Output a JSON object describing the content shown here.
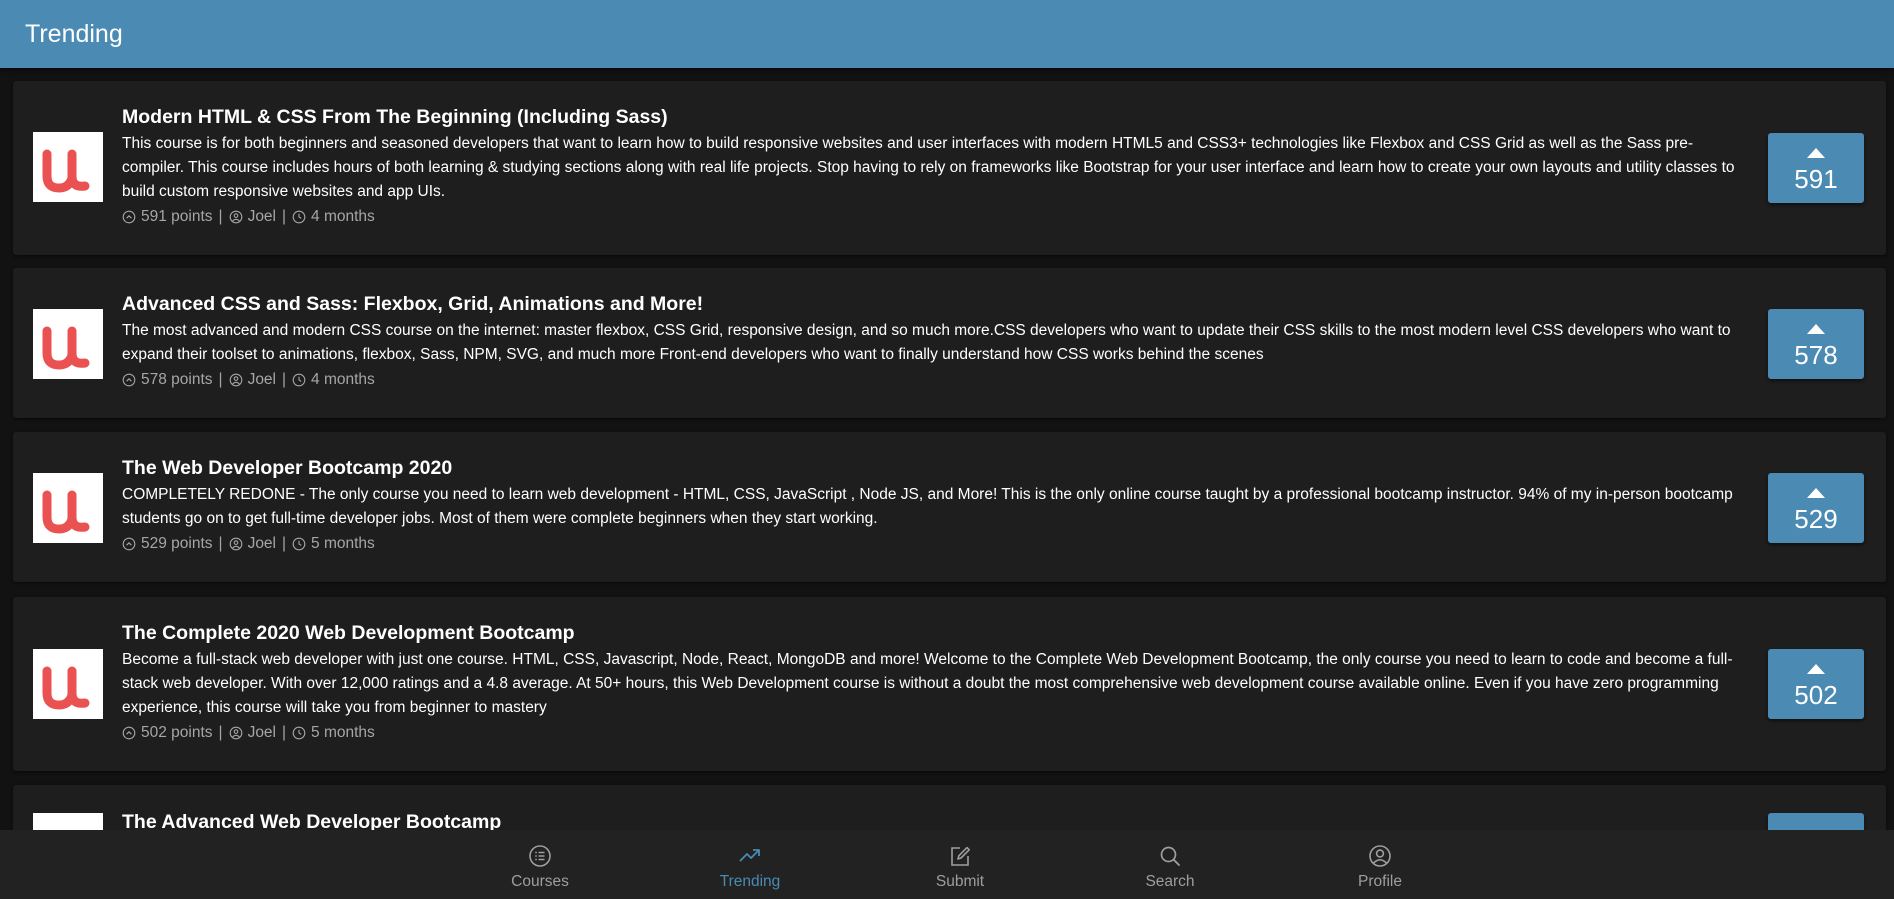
{
  "header": {
    "title": "Trending"
  },
  "courses": [
    {
      "title": "Modern HTML & CSS From The Beginning (Including Sass)",
      "description": "This course is for both beginners and seasoned developers that want to learn how to build responsive websites and user interfaces with modern HTML5 and CSS3+ technologies like Flexbox and CSS Grid as well as the Sass pre-compiler. This course includes hours of both learning & studying sections along with real life projects. Stop having to rely on frameworks like Bootstrap for your user interface and learn how to create your own layouts and utility classes to build custom responsive websites and app UIs.",
      "points": "591 points",
      "author": "Joel",
      "age": "4 months",
      "votes": "591"
    },
    {
      "title": "Advanced CSS and Sass: Flexbox, Grid, Animations and More!",
      "description": "The most advanced and modern CSS course on the internet: master flexbox, CSS Grid, responsive design, and so much more.CSS developers who want to update their CSS skills to the most modern level CSS developers who want to expand their toolset to animations, flexbox, Sass, NPM, SVG, and much more Front-end developers who want to finally understand how CSS works behind the scenes",
      "points": "578 points",
      "author": "Joel",
      "age": "4 months",
      "votes": "578"
    },
    {
      "title": "The Web Developer Bootcamp 2020",
      "description": "COMPLETELY REDONE - The only course you need to learn web development - HTML, CSS, JavaScript , Node JS, and More! This is the only online course taught by a professional bootcamp instructor. 94% of my in-person bootcamp students go on to get full-time developer jobs. Most of them were complete beginners when they start working.",
      "points": "529 points",
      "author": "Joel",
      "age": "5 months",
      "votes": "529"
    },
    {
      "title": "The Complete 2020 Web Development Bootcamp",
      "description": "Become a full-stack web developer with just one course. HTML, CSS, Javascript, Node, React, MongoDB and more! Welcome to the Complete Web Development Bootcamp, the only course you need to learn to code and become a full-stack web developer. With over 12,000 ratings and a 4.8 average. At 50+ hours, this Web Development course is without a doubt the most comprehensive web development course available online. Even if you have zero programming experience, this course will take you from beginner to mastery",
      "points": "502 points",
      "author": "Joel",
      "age": "5 months",
      "votes": "502"
    },
    {
      "title": "The Advanced Web Developer Bootcamp"
    }
  ],
  "icons": {
    "course_logo": "udemy-logo-icon",
    "points": "arrow-up-circle-icon",
    "author": "user-circle-icon",
    "age": "clock-icon",
    "vote": "triangle-up-icon"
  },
  "nav": {
    "items": [
      {
        "label": "Courses",
        "icon": "list-icon",
        "active": false
      },
      {
        "label": "Trending",
        "icon": "trending-up-icon",
        "active": true
      },
      {
        "label": "Submit",
        "icon": "edit-icon",
        "active": false
      },
      {
        "label": "Search",
        "icon": "search-icon",
        "active": false
      },
      {
        "label": "Profile",
        "icon": "user-circle-icon",
        "active": false
      }
    ]
  },
  "colors": {
    "accent": "#4a8ab3",
    "background": "#121212",
    "card": "#1e1e1e",
    "logo_red": "#ea5252",
    "muted_text": "#a6a6a6"
  }
}
